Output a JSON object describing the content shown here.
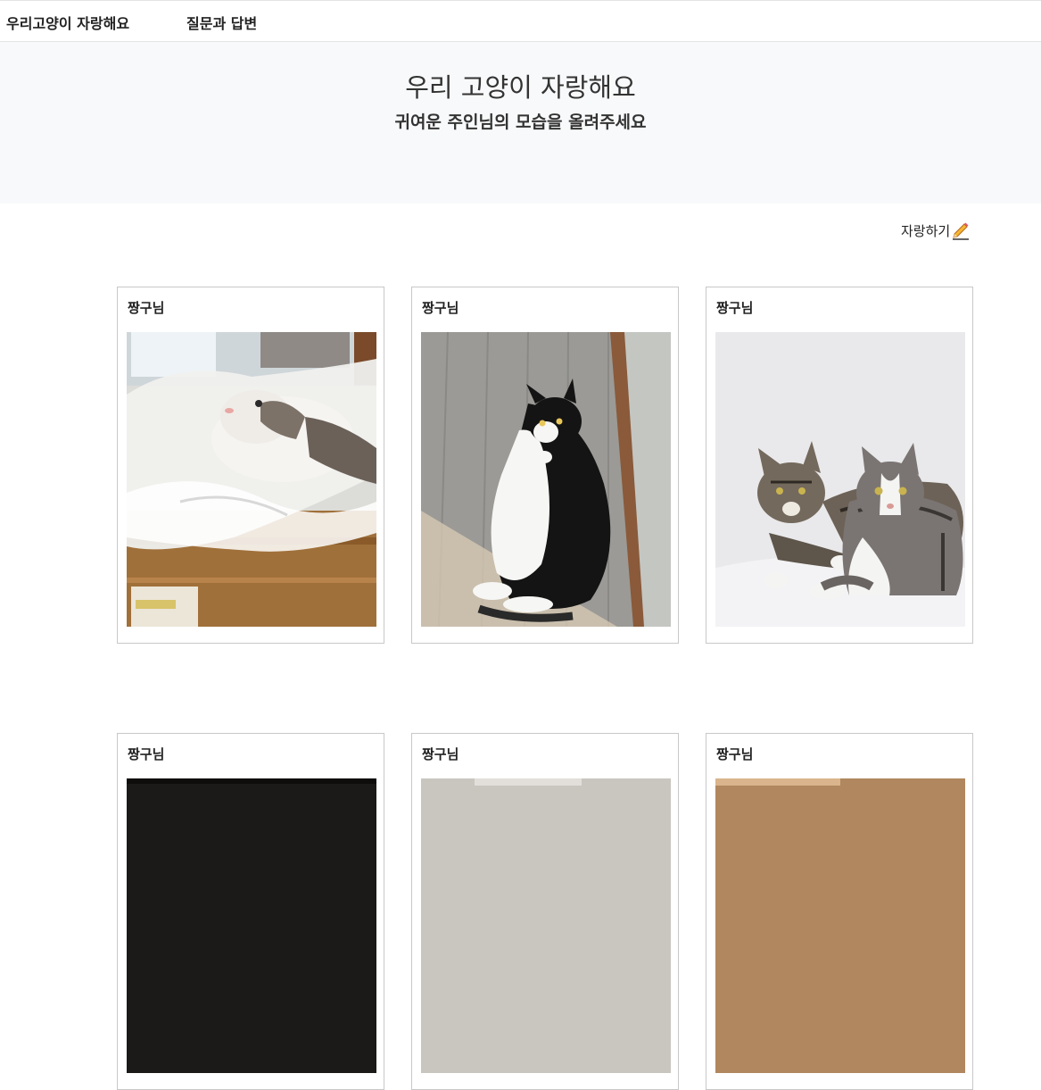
{
  "nav": {
    "brand": "우리고양이 자랑해요",
    "qa": "질문과 답변"
  },
  "hero": {
    "title": "우리 고양이 자랑해요",
    "subtitle": "귀여운 주인님의 모습을 올려주세요"
  },
  "actions": {
    "brag_label": "자랑하기",
    "brag_icon": "pencil-icon"
  },
  "posts": [
    {
      "title": "짱구님",
      "photo": "cat-in-plastic-bag-photo"
    },
    {
      "title": "짱구님",
      "photo": "tuxedo-cat-on-floor-photo"
    },
    {
      "title": "짱구님",
      "photo": "two-tabby-cats-photo"
    },
    {
      "title": "짱구님",
      "photo": "cat-photo"
    },
    {
      "title": "짱구님",
      "photo": "cat-photo"
    },
    {
      "title": "짱구님",
      "photo": "cat-photo"
    }
  ],
  "colors": {
    "hero_bg": "#f8f9fa",
    "card_border": "#c8c8c8"
  }
}
